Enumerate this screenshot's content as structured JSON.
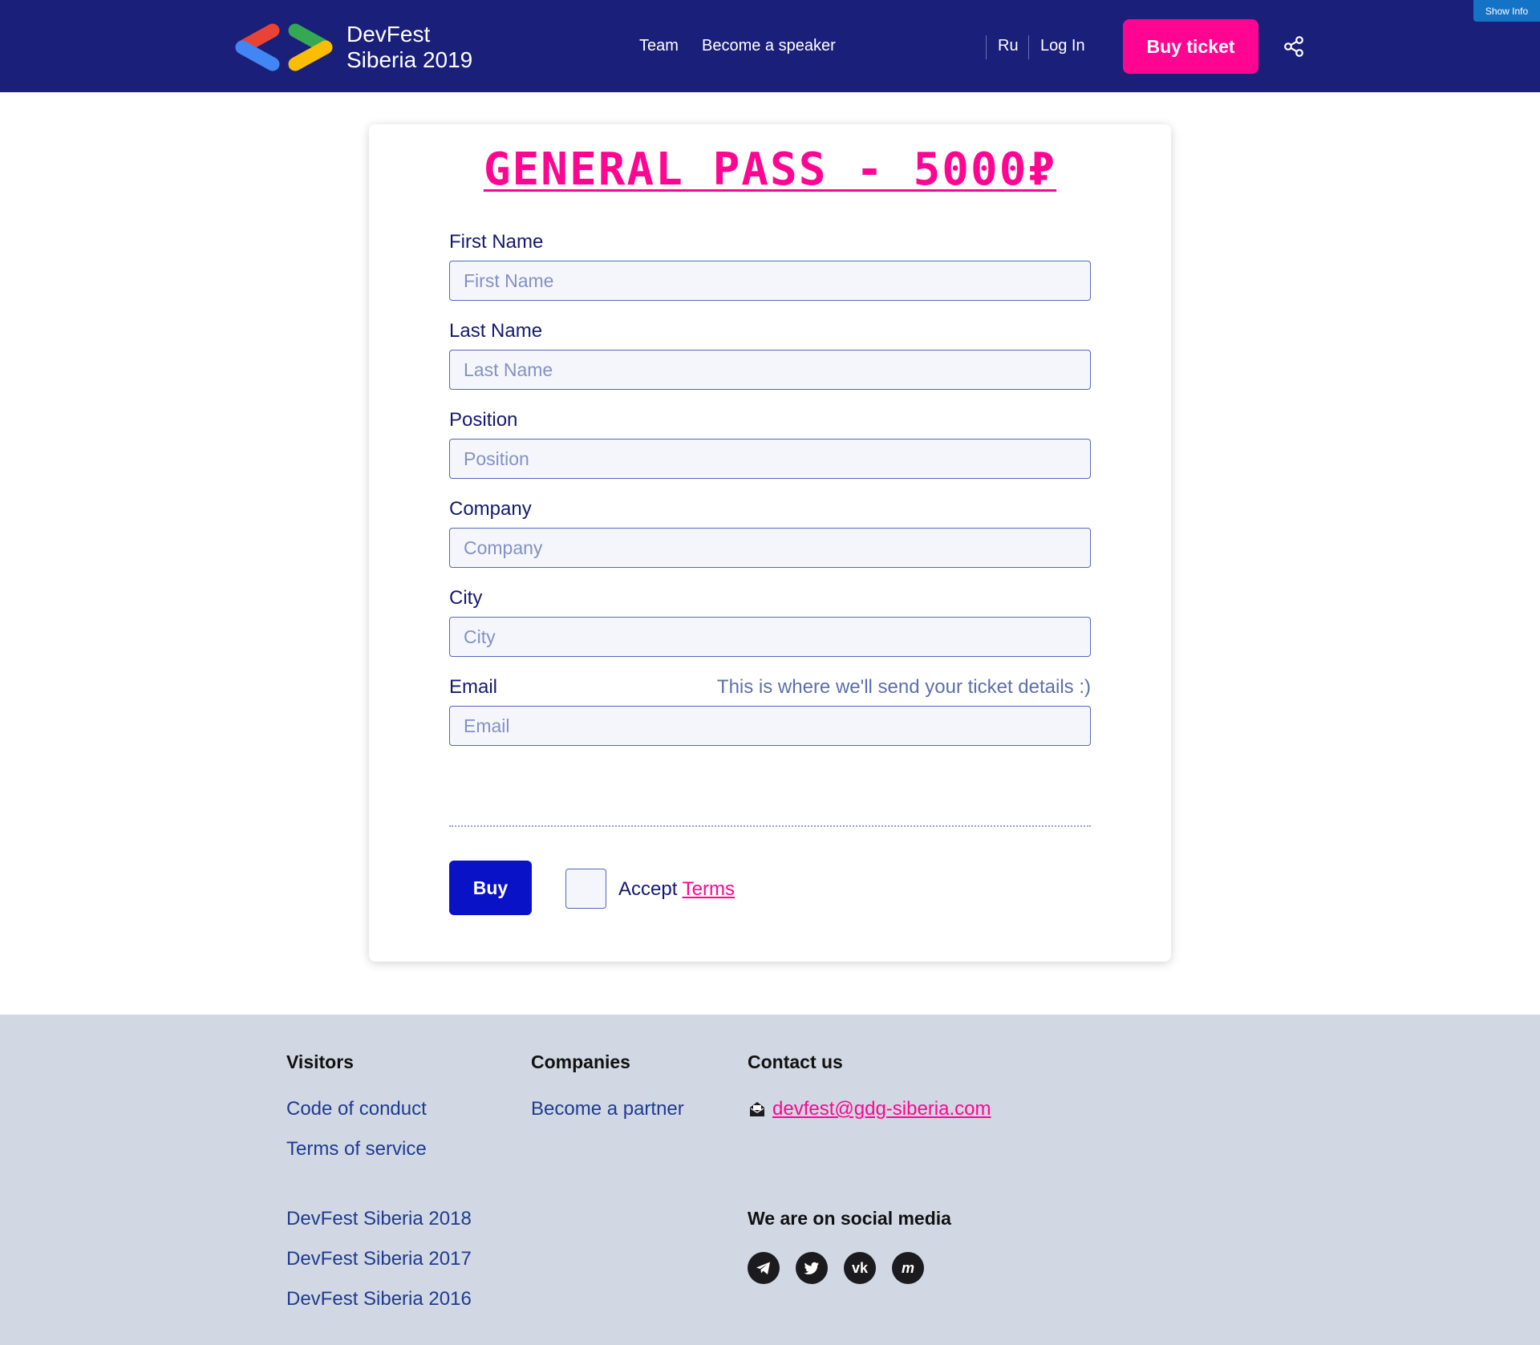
{
  "header": {
    "logo_line1": "DevFest",
    "logo_line2": "Siberia 2019",
    "nav": [
      "Team",
      "Become a speaker"
    ],
    "lang": "Ru",
    "login": "Log In",
    "buy_ticket": "Buy ticket",
    "show_info": "Show Info"
  },
  "form": {
    "title": "GENERAL PASS - 5000₽",
    "fields": [
      {
        "label": "First Name",
        "placeholder": "First Name",
        "value": ""
      },
      {
        "label": "Last Name",
        "placeholder": "Last Name",
        "value": ""
      },
      {
        "label": "Position",
        "placeholder": "Position",
        "value": ""
      },
      {
        "label": "Company",
        "placeholder": "Company",
        "value": ""
      },
      {
        "label": "City",
        "placeholder": "City",
        "value": ""
      },
      {
        "label": "Email",
        "placeholder": "Email",
        "value": "",
        "hint": "This is where we'll send your ticket details :)"
      }
    ],
    "buy": "Buy",
    "accept": "Accept",
    "terms": "Terms"
  },
  "footer": {
    "visitors": {
      "heading": "Visitors",
      "links": [
        "Code of conduct",
        "Terms of service"
      ],
      "past": [
        "DevFest Siberia 2018",
        "DevFest Siberia 2017",
        "DevFest Siberia 2016"
      ]
    },
    "companies": {
      "heading": "Companies",
      "links": [
        "Become a partner"
      ]
    },
    "contact": {
      "heading": "Contact us",
      "email": "devfest@gdg-siberia.com"
    },
    "social": {
      "heading": "We are on social media",
      "icons": [
        "telegram-icon",
        "twitter-icon",
        "vk-icon",
        "meetup-icon"
      ]
    }
  },
  "colors": {
    "header_bg": "#1a1f7a",
    "accent_pink": "#ff0592",
    "buy_blue": "#0a12c7",
    "footer_bg": "#d1d8e3"
  }
}
